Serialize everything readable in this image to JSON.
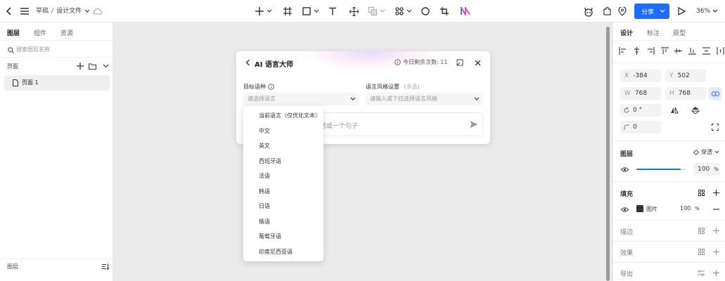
{
  "topbar": {
    "breadcrumb_root": "草稿",
    "breadcrumb_sep": "/",
    "file_name": "设计文件",
    "share_label": "分享",
    "zoom": "36%"
  },
  "left_panel": {
    "tabs": [
      "图层",
      "组件",
      "资源"
    ],
    "search_placeholder": "搜索图层名称",
    "pages_label": "页面",
    "page_item": "页面 1",
    "layers_label": "图层"
  },
  "dialog": {
    "title": "AI 语言大师",
    "remaining": "今日剩余次数: 11",
    "target_label": "目标语种",
    "target_placeholder": "请选择语言",
    "style_label": "语言风格设置",
    "style_hint": "(多选)",
    "style_placeholder": "请输入或下拉选择语言风格",
    "input_partial": "话或一个句子",
    "options": [
      "当前语言（仅优化文本）",
      "中文",
      "英文",
      "西班牙语",
      "法语",
      "韩语",
      "日语",
      "俄语",
      "葡萄牙语",
      "印度尼西亚语"
    ]
  },
  "right_panel": {
    "tabs": [
      "设计",
      "标注",
      "原型"
    ],
    "x_label": "X",
    "x_value": "-384",
    "y_label": "Y",
    "y_value": "502",
    "w_label": "W",
    "w_value": "768",
    "h_label": "H",
    "h_value": "768",
    "rotation": "0 °",
    "radius": "0",
    "layer_title": "图层",
    "blend_mode": "穿透",
    "opacity": "100",
    "percent": "%",
    "opacity_fill_fraction": 0.9,
    "fill_title": "填充",
    "fill_type": "图片",
    "fill_opacity": "100",
    "stroke_title": "描边",
    "effect_title": "效果",
    "export_title": "导出"
  },
  "colors": {
    "accent": "#1e6cff",
    "share_bg": "#1e6cff"
  }
}
